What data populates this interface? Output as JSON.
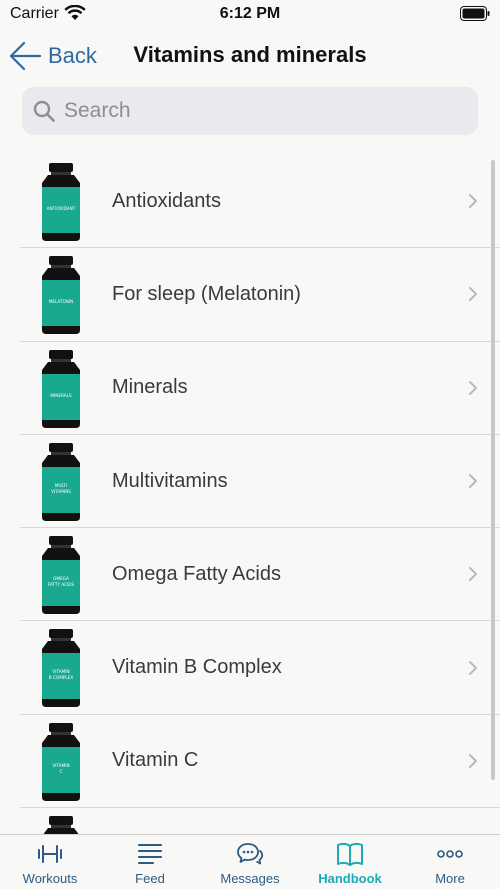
{
  "status": {
    "carrier": "Carrier",
    "time": "6:12 PM"
  },
  "nav": {
    "back_label": "Back",
    "title": "Vitamins and minerals"
  },
  "search": {
    "placeholder": "Search",
    "value": ""
  },
  "colors": {
    "accent": "#1da9b8",
    "link": "#2d6aa0",
    "bottle_label": "#19a98e",
    "bottle": "#111111"
  },
  "items": [
    {
      "label": "Antioxidants",
      "bottle_text": "ANTIOXIDANT"
    },
    {
      "label": "For sleep (Melatonin)",
      "bottle_text": "MELATONIN"
    },
    {
      "label": "Minerals",
      "bottle_text": "MINERALS"
    },
    {
      "label": "Multivitamins",
      "bottle_text": "MULTI VITAMINS"
    },
    {
      "label": "Omega Fatty Acids",
      "bottle_text": "OMEGA FATTY ACIDS"
    },
    {
      "label": "Vitamin B Complex",
      "bottle_text": "VITAMIN B COMPLEX"
    },
    {
      "label": "Vitamin C",
      "bottle_text": "VITAMIN C"
    }
  ],
  "tabs": [
    {
      "label": "Workouts",
      "icon": "dumbbell-icon",
      "active": false
    },
    {
      "label": "Feed",
      "icon": "feed-lines-icon",
      "active": false
    },
    {
      "label": "Messages",
      "icon": "chat-bubbles-icon",
      "active": false
    },
    {
      "label": "Handbook",
      "icon": "book-icon",
      "active": true
    },
    {
      "label": "More",
      "icon": "more-dots-icon",
      "active": false
    }
  ]
}
